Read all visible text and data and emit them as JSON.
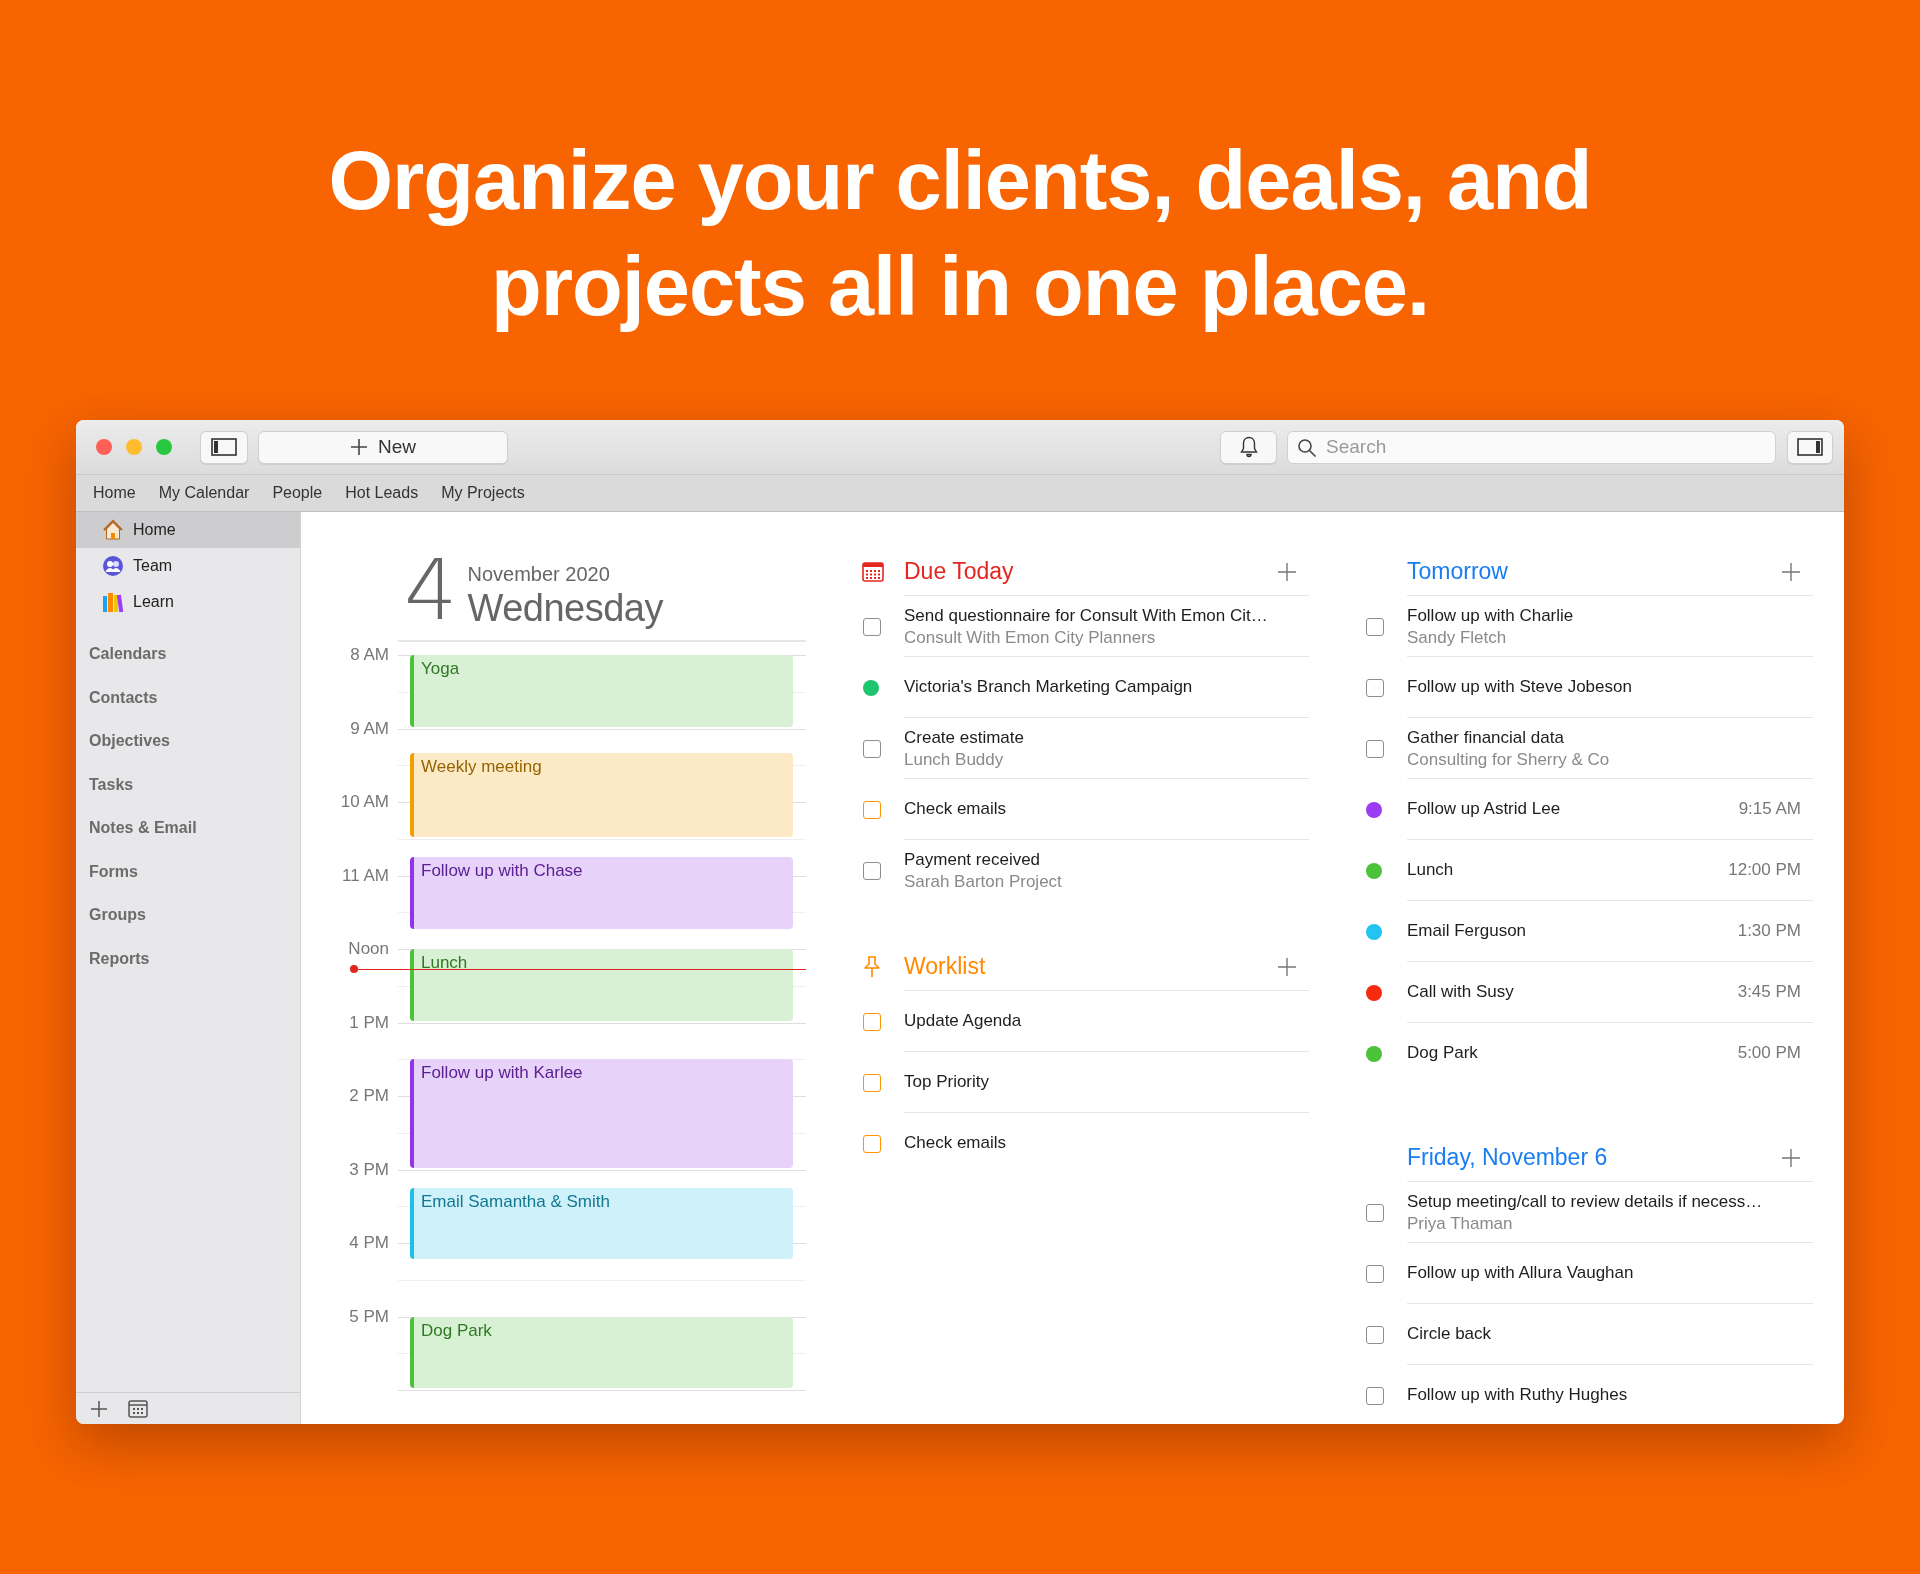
{
  "headline": [
    "Organize your clients, deals, and",
    "projects all in one place."
  ],
  "toolbar": {
    "new_button": "New",
    "search": {
      "placeholder": "Search"
    }
  },
  "nav_tabs": [
    "Home",
    "My Calendar",
    "People",
    "Hot Leads",
    "My Projects"
  ],
  "sidebar": {
    "items": [
      {
        "label": "Home",
        "selected": true
      },
      {
        "label": "Team",
        "selected": false
      },
      {
        "label": "Learn",
        "selected": false
      }
    ],
    "sections": [
      "Calendars",
      "Contacts",
      "Objectives",
      "Tasks",
      "Notes & Email",
      "Forms",
      "Groups",
      "Reports"
    ]
  },
  "day_view": {
    "day": "4",
    "month_year": "November 2020",
    "weekday": "Wednesday",
    "hours": [
      "8 AM",
      "9 AM",
      "10 AM",
      "11 AM",
      "Noon",
      "1 PM",
      "2 PM",
      "3 PM",
      "4 PM",
      "5 PM"
    ],
    "events": [
      {
        "title": "Yoga",
        "color": "#4cc13a"
      },
      {
        "title": "Weekly meeting",
        "color": "#f0a000"
      },
      {
        "title": "Follow up with Chase",
        "color": "#9333ea"
      },
      {
        "title": "Lunch",
        "color": "#4cc13a"
      },
      {
        "title": "Follow up with Karlee",
        "color": "#9333ea"
      },
      {
        "title": "Email Samantha & Smith",
        "color": "#1ec0e8"
      },
      {
        "title": "Dog Park",
        "color": "#4cc13a"
      }
    ]
  },
  "columns": [
    {
      "sections": [
        {
          "title": "Due Today",
          "kind": "due",
          "color": "#e5261f",
          "items": [
            {
              "kind": "checkbox",
              "color": "#8e8e8e",
              "checked": false,
              "title": "Send questionnaire for Consult With Emon Cit…",
              "subtitle": "Consult With Emon City Planners"
            },
            {
              "kind": "dot",
              "color": "#1fc46f",
              "title": "Victoria's Branch Marketing Campaign"
            },
            {
              "kind": "checkbox",
              "color": "#8e8e8e",
              "checked": false,
              "title": "Create estimate",
              "subtitle": "Lunch Buddy"
            },
            {
              "kind": "checkbox",
              "color": "#ff9500",
              "checked": false,
              "title": "Check emails"
            },
            {
              "kind": "checkbox",
              "color": "#8e8e8e",
              "checked": false,
              "title": "Payment received",
              "subtitle": "Sarah Barton Project"
            }
          ]
        },
        {
          "title": "Worklist",
          "kind": "worklist",
          "color": "#ff8a00",
          "items": [
            {
              "kind": "checkbox",
              "color": "#ff9500",
              "checked": false,
              "title": "Update Agenda"
            },
            {
              "kind": "checkbox",
              "color": "#ff9500",
              "checked": false,
              "title": "Top Priority"
            },
            {
              "kind": "checkbox",
              "color": "#ff9500",
              "checked": false,
              "title": "Check emails"
            }
          ]
        }
      ]
    },
    {
      "sections": [
        {
          "title": "Tomorrow",
          "kind": "day",
          "color": "#1a7df0",
          "items": [
            {
              "kind": "checkbox",
              "color": "#8e8e8e",
              "checked": false,
              "title": "Follow up with Charlie",
              "subtitle": "Sandy Fletch"
            },
            {
              "kind": "checkbox",
              "color": "#8e8e8e",
              "checked": false,
              "title": "Follow up with Steve Jobeson"
            },
            {
              "kind": "checkbox",
              "color": "#8e8e8e",
              "checked": false,
              "title": "Gather financial data",
              "subtitle": "Consulting for Sherry & Co"
            },
            {
              "kind": "dot",
              "color": "#9b3df5",
              "title": "Follow up Astrid Lee",
              "time": "9:15 AM"
            },
            {
              "kind": "dot",
              "color": "#4cc13a",
              "title": "Lunch",
              "time": "12:00 PM"
            },
            {
              "kind": "dot",
              "color": "#23c4f2",
              "title": "Email Ferguson",
              "time": "1:30 PM"
            },
            {
              "kind": "dot",
              "color": "#f52a0f",
              "title": "Call with Susy",
              "time": "3:45 PM"
            },
            {
              "kind": "dot",
              "color": "#4cc13a",
              "title": "Dog Park",
              "time": "5:00 PM"
            }
          ]
        },
        {
          "title": "Friday, November 6",
          "kind": "day",
          "color": "#1a7df0",
          "items": [
            {
              "kind": "checkbox",
              "color": "#8e8e8e",
              "checked": false,
              "title": "Setup meeting/call to review details if necess…",
              "subtitle": "Priya Thaman"
            },
            {
              "kind": "checkbox",
              "color": "#8e8e8e",
              "checked": false,
              "title": "Follow up with Allura Vaughan"
            },
            {
              "kind": "checkbox",
              "color": "#8e8e8e",
              "checked": false,
              "title": "Circle back"
            },
            {
              "kind": "checkbox",
              "color": "#8e8e8e",
              "checked": false,
              "title": "Follow up with Ruthy Hughes"
            }
          ]
        }
      ]
    }
  ]
}
